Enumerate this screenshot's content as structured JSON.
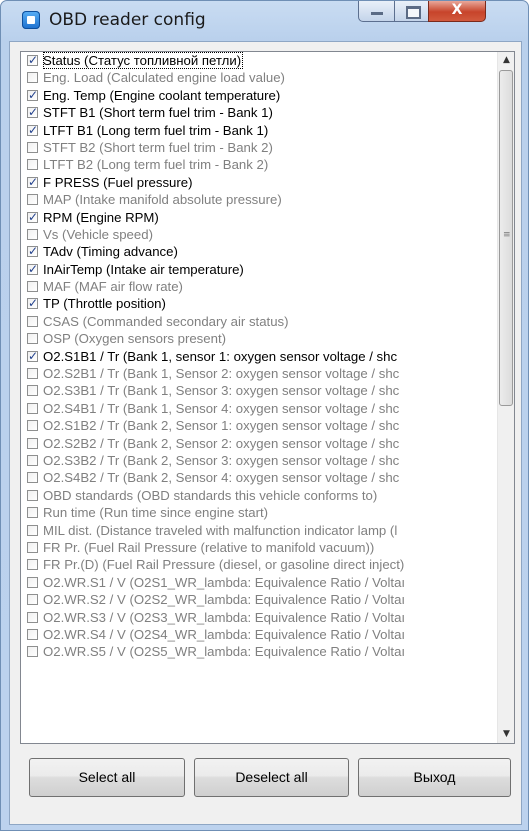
{
  "window": {
    "title": "OBD reader config"
  },
  "caption_buttons": {
    "close_glyph": "X"
  },
  "list": {
    "items": [
      {
        "label": "Status (Статус топливной петли)",
        "checked": true
      },
      {
        "label": "Eng. Load (Calculated engine load value)",
        "checked": false
      },
      {
        "label": "Eng. Temp (Engine coolant temperature)",
        "checked": true
      },
      {
        "label": "STFT B1 (Short term fuel trim - Bank 1)",
        "checked": true
      },
      {
        "label": "LTFT B1 (Long term fuel trim - Bank 1)",
        "checked": true
      },
      {
        "label": "STFT B2 (Short term fuel trim - Bank 2)",
        "checked": false
      },
      {
        "label": "LTFT B2 (Long term fuel trim - Bank 2)",
        "checked": false
      },
      {
        "label": "F PRESS (Fuel pressure)",
        "checked": true
      },
      {
        "label": "MAP (Intake manifold absolute pressure)",
        "checked": false
      },
      {
        "label": "RPM (Engine RPM)",
        "checked": true
      },
      {
        "label": "Vs (Vehicle speed)",
        "checked": false
      },
      {
        "label": "TAdv (Timing advance)",
        "checked": true
      },
      {
        "label": "InAirTemp (Intake air temperature)",
        "checked": true
      },
      {
        "label": "MAF (MAF air flow rate)",
        "checked": false
      },
      {
        "label": "TP (Throttle position)",
        "checked": true
      },
      {
        "label": "CSAS (Commanded secondary air status)",
        "checked": false
      },
      {
        "label": "OSP (Oxygen sensors present)",
        "checked": false
      },
      {
        "label": "O2.S1B1 / Tr (Bank 1, sensor 1: oxygen sensor voltage / shc",
        "checked": true
      },
      {
        "label": "O2.S2B1 / Tr (Bank 1, Sensor 2: oxygen sensor voltage / shc",
        "checked": false
      },
      {
        "label": "O2.S3B1 / Tr (Bank 1, Sensor 3: oxygen sensor voltage / shc",
        "checked": false
      },
      {
        "label": "O2.S4B1 / Tr (Bank 1, Sensor 4: oxygen sensor voltage / shc",
        "checked": false
      },
      {
        "label": "O2.S1B2 / Tr (Bank 2, Sensor 1: oxygen sensor voltage / shc",
        "checked": false
      },
      {
        "label": "O2.S2B2 / Tr (Bank 2, Sensor 2: oxygen sensor voltage / shc",
        "checked": false
      },
      {
        "label": "O2.S3B2 / Tr (Bank 2, Sensor 3: oxygen sensor voltage / shc",
        "checked": false
      },
      {
        "label": "O2.S4B2 / Tr (Bank 2, Sensor 4: oxygen sensor voltage / shc",
        "checked": false
      },
      {
        "label": "OBD standards (OBD standards this vehicle conforms to)",
        "checked": false
      },
      {
        "label": "Run time (Run time since engine start)",
        "checked": false
      },
      {
        "label": "MIL dist. (Distance traveled with malfunction indicator lamp (l",
        "checked": false
      },
      {
        "label": "FR Pr. (Fuel Rail Pressure (relative to manifold vacuum))",
        "checked": false
      },
      {
        "label": "FR Pr.(D) (Fuel Rail Pressure (diesel, or gasoline direct inject)",
        "checked": false
      },
      {
        "label": "O2.WR.S1 / V (O2S1_WR_lambda: Equivalence Ratio / Voltaı",
        "checked": false
      },
      {
        "label": "O2.WR.S2 / V (O2S2_WR_lambda: Equivalence Ratio / Voltaı",
        "checked": false
      },
      {
        "label": "O2.WR.S3 / V (O2S3_WR_lambda: Equivalence Ratio / Voltaı",
        "checked": false
      },
      {
        "label": "O2.WR.S4 / V (O2S4_WR_lambda: Equivalence Ratio / Voltaı",
        "checked": false
      },
      {
        "label": "O2.WR.S5 / V (O2S5_WR_lambda: Equivalence Ratio / Voltaı",
        "checked": false
      }
    ],
    "scroll_position": 0.0
  },
  "buttons": {
    "select_all": "Select all",
    "deselect_all": "Deselect all",
    "exit": "Выход"
  }
}
